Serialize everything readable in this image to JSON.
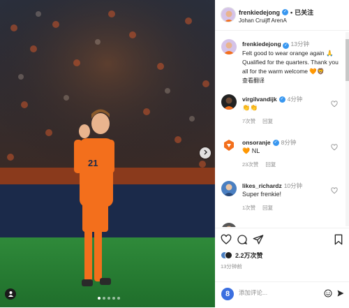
{
  "post": {
    "username": "frenkiedejong",
    "follow_label": "已关注",
    "location": "Johan Cruijff ArenA",
    "caption_time": "13分钟",
    "caption_lines": [
      "Felt good to wear orange again 🙏",
      "Qualified for the quarters. Thank you",
      "all for the warm welcome 🧡🦁"
    ],
    "see_translation": "查看翻译",
    "photo": {
      "slide_count": 5,
      "active_slide": 0
    }
  },
  "comments": [
    {
      "username": "virgilvandijk",
      "verified": true,
      "time": "4分钟",
      "text": "👏👏",
      "likes": "7次赞",
      "reply": "回复"
    },
    {
      "username": "onsoranje",
      "verified": true,
      "time": "8分钟",
      "text": "🧡 NL",
      "likes": "23次赞",
      "reply": "回复"
    },
    {
      "username": "likes_richardz",
      "verified": false,
      "time": "10分钟",
      "text": "Super frenkie!",
      "likes": "1次赞",
      "reply": "回复"
    }
  ],
  "actions": {
    "likes_label": "2.2万次赞",
    "posted_time": "13分钟前",
    "comment_placeholder": "添加评论...",
    "icons": [
      "heart-icon",
      "comment-icon",
      "share-icon",
      "bookmark-icon"
    ]
  },
  "colors": {
    "verified": "#3897f0",
    "jersey": "#f36f1c",
    "brand": "#3b6fe0"
  }
}
